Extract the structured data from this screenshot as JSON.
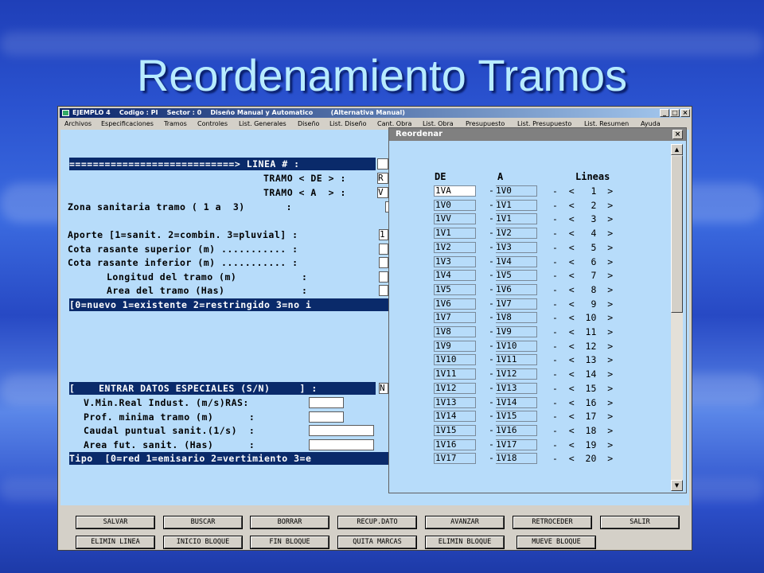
{
  "slide": {
    "title": "Reordenamiento Tramos"
  },
  "window": {
    "title": "EJEMPLO 4    Codigo : PI    Sector : 0    Diseño Manual y Automatico        (Alternativa Manual)",
    "controls": [
      "_",
      "□",
      "×"
    ]
  },
  "menu": [
    "Archivos",
    "Especificaciones",
    "Tramos",
    "Controles",
    "List. Generales",
    "Diseño",
    "List. Diseño",
    "Cant. Obra",
    "List. Obra",
    "Presupuesto",
    "List. Presupuesto",
    "List. Resumen",
    "Ayuda"
  ],
  "form": {
    "linea_band": "============================> LINEA # :",
    "tramo_de": "TRAMO < DE > :",
    "tramo_de_value": "R",
    "tramo_a": "TRAMO < A  > :",
    "tramo_a_value": "V",
    "zona": "Zona sanitaria tramo ( 1 a  3)       :",
    "aporte": "Aporte [1=sanit. 2=combin. 3=pluvial] :",
    "aporte_value": "1",
    "cota_sup": "Cota rasante superior (m) ........... :",
    "cota_inf": "Cota rasante inferior (m) ........... :",
    "longitud": "Longitud del tramo (m)           :",
    "area": "Area del tramo (Has)             :",
    "estado_band": "[0=nuevo 1=existente 2=restringido 3=no i",
    "especiales_band": "[    ENTRAR DATOS ESPECIALES (S/N)     ] :",
    "especiales_value": "N",
    "vmin": "V.Min.Real Indust. (m/s)RAS:",
    "prof": "Prof. minima tramo (m)      :",
    "caudal": "Caudal puntual sanit.(1/s)  :",
    "area_fut": "Area fut. sanit. (Has)      :",
    "tipo_band": "Tipo  [0=red 1=emisario 2=vertimiento 3=e"
  },
  "dialog": {
    "title": "Reordenar",
    "close": "×",
    "headers": {
      "de": "DE",
      "a": "A",
      "lineas": "Lineas"
    },
    "rows": [
      {
        "de": "1VA",
        "a": "1V0",
        "n": "1"
      },
      {
        "de": "1V0",
        "a": "1V1",
        "n": "2"
      },
      {
        "de": "1VV",
        "a": "1V1",
        "n": "3"
      },
      {
        "de": "1V1",
        "a": "1V2",
        "n": "4"
      },
      {
        "de": "1V2",
        "a": "1V3",
        "n": "5"
      },
      {
        "de": "1V3",
        "a": "1V4",
        "n": "6"
      },
      {
        "de": "1V4",
        "a": "1V5",
        "n": "7"
      },
      {
        "de": "1V5",
        "a": "1V6",
        "n": "8"
      },
      {
        "de": "1V6",
        "a": "1V7",
        "n": "9"
      },
      {
        "de": "1V7",
        "a": "1V8",
        "n": "10"
      },
      {
        "de": "1V8",
        "a": "1V9",
        "n": "11"
      },
      {
        "de": "1V9",
        "a": "1V10",
        "n": "12"
      },
      {
        "de": "1V10",
        "a": "1V11",
        "n": "13"
      },
      {
        "de": "1V11",
        "a": "1V12",
        "n": "14"
      },
      {
        "de": "1V12",
        "a": "1V13",
        "n": "15"
      },
      {
        "de": "1V13",
        "a": "1V14",
        "n": "16"
      },
      {
        "de": "1V14",
        "a": "1V15",
        "n": "17"
      },
      {
        "de": "1V15",
        "a": "1V16",
        "n": "18"
      },
      {
        "de": "1V16",
        "a": "1V17",
        "n": "19"
      },
      {
        "de": "1V17",
        "a": "1V18",
        "n": "20"
      }
    ]
  },
  "buttons": {
    "salvar": "SALVAR",
    "buscar": "BUSCAR",
    "borrar": "BORRAR",
    "recup": "RECUP.DATO",
    "avanzar": "AVANZAR",
    "retroceder": "RETROCEDER",
    "salir": "SALIR",
    "elimin_linea": "ELIMIN LINEA",
    "inicio_bloque": "INICIO BLOQUE",
    "fin_bloque": "FIN BLOQUE",
    "quita_marcas": "QUITA MARCAS",
    "elimin_bloque": "ELIMIN BLOQUE",
    "mueve_bloque": "MUEVE BLOQUE"
  }
}
